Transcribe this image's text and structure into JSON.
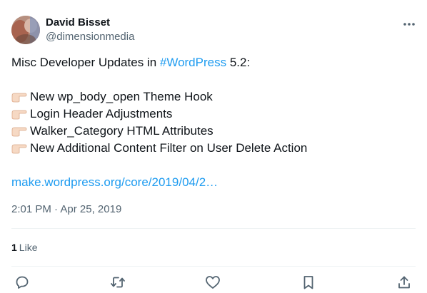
{
  "author": {
    "name": "David Bisset",
    "handle": "@dimensionmedia"
  },
  "tweet": {
    "intro_before": "Misc Developer Updates in ",
    "hashtag": "#WordPress",
    "intro_after": " 5.2:",
    "bullets": [
      {
        "icon": "backhand-index-pointing-right-icon",
        "text": "New wp_body_open Theme Hook"
      },
      {
        "icon": "backhand-index-pointing-right-icon",
        "text": "Login Header Adjustments"
      },
      {
        "icon": "backhand-index-pointing-right-icon",
        "text": "Walker_Category HTML Attributes"
      },
      {
        "icon": "backhand-index-pointing-right-icon",
        "text": "New Additional Content Filter on User Delete Action"
      }
    ],
    "link": "make.wordpress.org/core/2019/04/2…"
  },
  "meta": {
    "time": "2:01 PM",
    "separator": " · ",
    "date": "Apr 25, 2019"
  },
  "engagement": {
    "likes_count": "1",
    "likes_label": "Like"
  },
  "actions": [
    {
      "name": "reply-icon"
    },
    {
      "name": "retweet-icon"
    },
    {
      "name": "like-heart-icon"
    },
    {
      "name": "bookmark-icon"
    },
    {
      "name": "share-icon"
    }
  ],
  "colors": {
    "accent": "#1d9bf0",
    "text": "#0f1419",
    "secondary": "#536471",
    "divider": "#eff3f4",
    "icon": "#536471"
  }
}
